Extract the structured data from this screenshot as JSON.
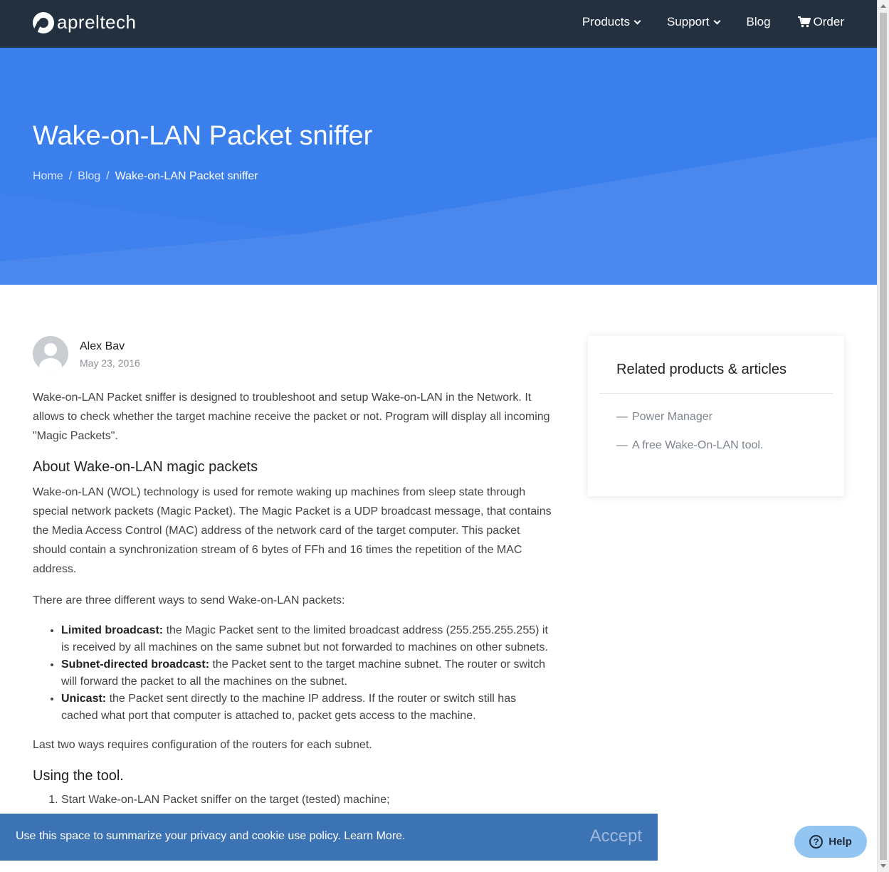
{
  "header": {
    "logo_text": "apreltech",
    "nav": [
      {
        "label": "Products",
        "icon": "chevron-down-icon"
      },
      {
        "label": "Support",
        "icon": "chevron-down-icon"
      },
      {
        "label": "Blog"
      },
      {
        "label": "Order",
        "icon": "cart-icon"
      }
    ]
  },
  "hero": {
    "title": "Wake-on-LAN Packet sniffer",
    "breadcrumb": [
      "Home",
      "Blog",
      "Wake-on-LAN Packet sniffer"
    ],
    "separator": "/",
    "background": "#3a7fec"
  },
  "post": {
    "author": "Alex Bav",
    "date": "May 23, 2016",
    "intro": "Wake-on-LAN Packet sniffer is designed to troubleshoot and setup Wake-on-LAN in the Network. It allows to check whether the target machine receive the packet or not. Program will display all incoming \"Magic Packets\".",
    "h_about": "About Wake-on-LAN magic packets",
    "p_about": "Wake-on-LAN (WOL) technology is used for remote waking up machines from sleep state through special network packets (Magic Packet). The Magic Packet is a UDP broadcast message, that contains the Media Access Control (MAC) address of the network card of the target computer. This packet should contain a synchronization stream of 6 bytes of FFh and 16 times the repetition of the MAC address.",
    "p_ways": "There are three different ways to send Wake-on-LAN packets:",
    "ways": [
      {
        "term": "Limited broadcast:",
        "text": " the Magic Packet sent to the limited broadcast address (255.255.255.255) it is received by all machines on the same subnet but not forwarded to machines on other subnets."
      },
      {
        "term": "Subnet-directed broadcast:",
        "text": " the Packet sent to the target machine subnet. The router or switch will forward the packet to all the machines on the subnet."
      },
      {
        "term": "Unicast:",
        "text": " the Packet sent directly to the machine IP address. If the router or switch still has cached what port that computer is attached to, packet gets access to the machine."
      }
    ],
    "p_last": "Last two ways requires configuration of the routers for each subnet.",
    "h_using": "Using the tool.",
    "steps": [
      "Start Wake-on-LAN Packet sniffer on the target (tested) machine;"
    ]
  },
  "sidebar": {
    "title": "Related products & articles",
    "dash": "—",
    "links": [
      "Power Manager",
      "A free Wake-On-LAN tool."
    ]
  },
  "cookie": {
    "text": "Use this space to summarize your privacy and cookie use policy. Learn More.",
    "accept": "Accept"
  },
  "help": {
    "label": "Help",
    "icon_glyph": "?"
  }
}
